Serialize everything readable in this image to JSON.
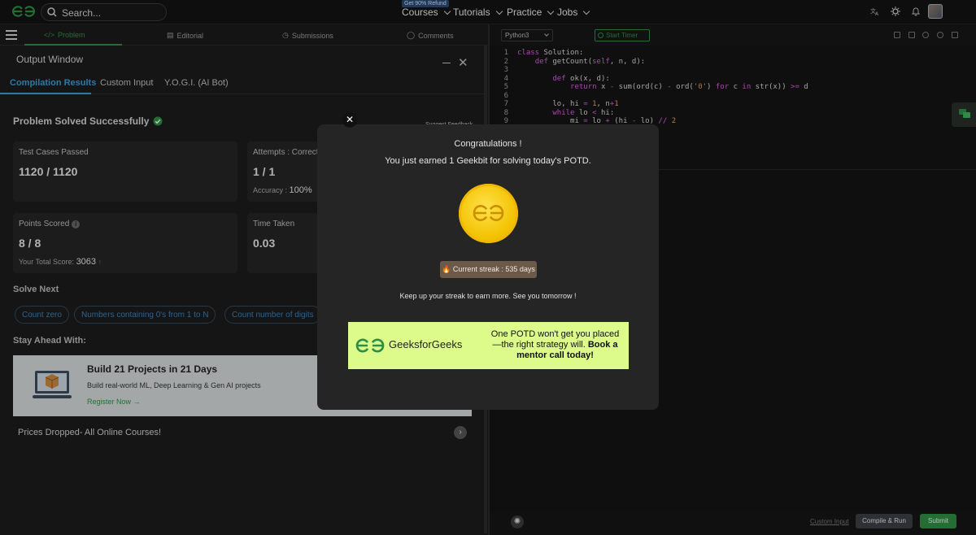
{
  "navbar": {
    "search_placeholder": "Search...",
    "refund_badge": "Get 90% Refund",
    "items": [
      "Courses",
      "Tutorials",
      "Practice",
      "Jobs"
    ]
  },
  "left_tabs": [
    "Problem",
    "Editorial",
    "Submissions",
    "Comments"
  ],
  "output_window": {
    "title": "Output Window",
    "subtabs": [
      "Compilation Results",
      "Custom Input",
      "Y.O.G.I. (AI Bot)"
    ],
    "status": "Problem Solved Successfully",
    "feedback_link": "Suggest Feedback",
    "test_cases_label": "Test Cases Passed",
    "test_cases_value": "1120 / 1120",
    "attempts_label": "Attempts : Correct / Total",
    "attempts_value": "1 / 1",
    "accuracy_label": "Accuracy :",
    "accuracy_value": "100%",
    "points_label": "Points Scored",
    "points_value": "8 / 8",
    "total_score_label": "Your Total Score:",
    "total_score_value": "3063",
    "time_label": "Time Taken",
    "time_value": "0.03",
    "solve_next_heading": "Solve Next",
    "solve_next": [
      "Count zero",
      "Numbers containing 0's from 1 to N",
      "Count number of digits"
    ],
    "stay_ahead_heading": "Stay Ahead With:",
    "banner_title": "Build 21 Projects in 21 Days",
    "banner_desc": "Build real-world ML, Deep Learning & Gen AI projects",
    "banner_link": "Register Now →",
    "prices_text": "Prices Dropped- All Online Courses!"
  },
  "editor": {
    "language": "Python3",
    "timer_label": "Start Timer",
    "line_numbers": [
      "1",
      "2",
      "3",
      "4",
      "5",
      "6",
      "7",
      "8",
      "9"
    ],
    "custom_input": "Custom Input",
    "compile_run": "Compile & Run",
    "submit": "Submit"
  },
  "modal": {
    "title": "Congratulations !",
    "message": "You just earned 1 Geekbit for solving today's POTD.",
    "streak": "🔥 Current streak : 535 days",
    "footer": "Keep up your streak to earn more. See you tomorrow !",
    "ad_brand": "GeeksforGeeks",
    "ad_text_1": "One POTD won't get you placed —the right strategy will.",
    "ad_text_2": "Book a mentor call today!"
  },
  "colors": {
    "accent_green": "#2f8d46",
    "link_blue": "#3a9bd9",
    "coin_gold": "#f2c200",
    "ad_bg": "#dcfb8a"
  }
}
